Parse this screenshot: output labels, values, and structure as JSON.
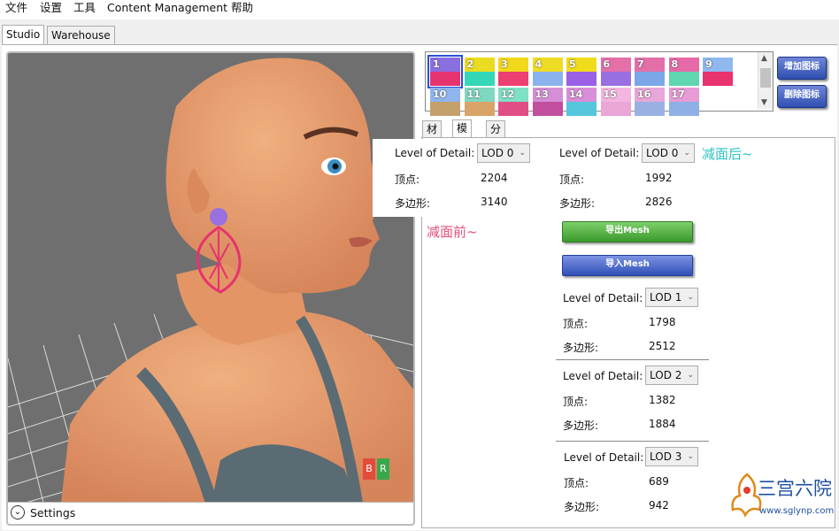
{
  "menu": [
    "文件",
    "设置",
    "工具",
    "Content Management",
    "帮助"
  ],
  "top_tabs": [
    "Studio",
    "Warehouse"
  ],
  "viewport": {
    "settings_label": "Settings",
    "badge_b": "B",
    "badge_r": "R"
  },
  "swatches": [
    {
      "num": "1",
      "top": "#8a6fe0",
      "bottom": "#e5336f"
    },
    {
      "num": "2",
      "top": "#eadc20",
      "bottom": "#34d8b8"
    },
    {
      "num": "3",
      "top": "#f2d81a",
      "bottom": "#ec3f72"
    },
    {
      "num": "4",
      "top": "#eedc25",
      "bottom": "#8ab3ee"
    },
    {
      "num": "5",
      "top": "#f1dc1b",
      "bottom": "#9a60e6"
    },
    {
      "num": "6",
      "top": "#e56fa9",
      "bottom": "#9a6fe1"
    },
    {
      "num": "7",
      "top": "#e36fa9",
      "bottom": "#7ba7e8"
    },
    {
      "num": "8",
      "top": "#e66aa7",
      "bottom": "#5fd6b0"
    },
    {
      "num": "9",
      "top": "#90b8ef",
      "bottom": "#e8336f"
    },
    {
      "num": "10",
      "top": "#8fb5ee",
      "bottom": "#c4a06c"
    },
    {
      "num": "11",
      "top": "#7fd8c0",
      "bottom": "#d9a467"
    },
    {
      "num": "12",
      "top": "#7fe0c6",
      "bottom": "#e04e86"
    },
    {
      "num": "13",
      "top": "#d58fd6",
      "bottom": "#c24f9d"
    },
    {
      "num": "14",
      "top": "#d98ed8",
      "bottom": "#56c6dc"
    },
    {
      "num": "15",
      "top": "#f4b6e0",
      "bottom": "#e9a6d6"
    },
    {
      "num": "16",
      "top": "#e9a6d9",
      "bottom": "#9ab0e2"
    },
    {
      "num": "17",
      "top": "#e89bd5",
      "bottom": "#8fb0e4"
    }
  ],
  "buttons": {
    "add_icon": "增加图标",
    "delete_icon": "删除图标",
    "export_mesh": "导出Mesh",
    "import_mesh": "导入Mesh"
  },
  "sub_tabs": [
    "材质",
    "模型",
    "分类"
  ],
  "labels": {
    "lod": "Level of Detail:",
    "vertices": "顶点:",
    "polygons": "多边形:"
  },
  "before": {
    "lod": "LOD 0",
    "vertices": "2204",
    "polygons": "3140",
    "annotation": "减面前~"
  },
  "after": {
    "lod": "LOD 0",
    "vertices": "1992",
    "polygons": "2826",
    "annotation": "减面后~"
  },
  "lods": [
    {
      "lod": "LOD 1",
      "vertices": "1798",
      "polygons": "2512"
    },
    {
      "lod": "LOD 2",
      "vertices": "1382",
      "polygons": "1884"
    },
    {
      "lod": "LOD 3",
      "vertices": "689",
      "polygons": "942"
    }
  ],
  "watermark": {
    "title": "三宫六院",
    "url": "www.sglynp.com"
  },
  "colors": {
    "teal_annotation": "#2bc4c0",
    "pink_annotation": "#e44f7a",
    "selection_blue": "#2a4fd6"
  }
}
